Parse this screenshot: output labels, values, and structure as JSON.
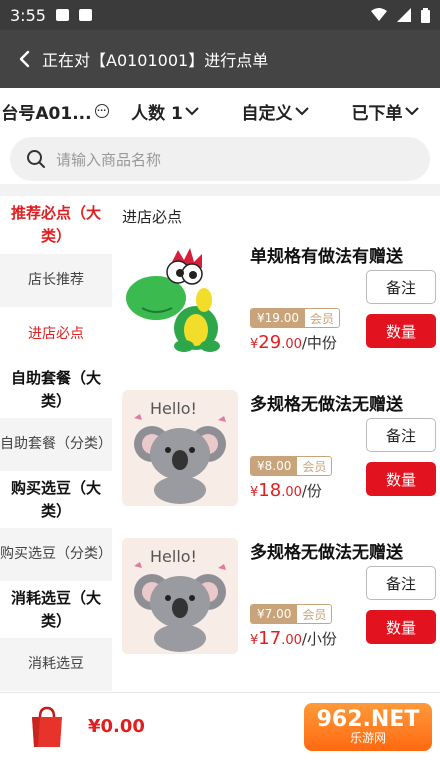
{
  "status": {
    "time": "3:55"
  },
  "header": {
    "title": "正在对【A0101001】进行点单"
  },
  "filters": [
    {
      "label": "台号A01..."
    },
    {
      "label": "人数 1"
    },
    {
      "label": "自定义"
    },
    {
      "label": "已下单"
    }
  ],
  "search": {
    "placeholder": "请输入商品名称"
  },
  "sidebar": {
    "items": [
      {
        "label": "推荐必点（大类）"
      },
      {
        "label": "店长推荐"
      },
      {
        "label": "进店必点"
      },
      {
        "label": "自助套餐（大类）"
      },
      {
        "label": "自助套餐（分类）"
      },
      {
        "label": "购买选豆（大类）"
      },
      {
        "label": "购买选豆（分类）"
      },
      {
        "label": "消耗选豆（大类）"
      },
      {
        "label": "消耗选豆"
      }
    ]
  },
  "main": {
    "section_title": "进店必点",
    "products": [
      {
        "name": "单规格有做法有赠送",
        "member_price": "¥19.00",
        "member_label": "会员",
        "price_symbol": "¥",
        "price_main": "29",
        "price_decimal": ".00",
        "unit": "/中份",
        "note_label": "备注",
        "qty_label": "数量"
      },
      {
        "name": "多规格无做法无赠送",
        "member_price": "¥8.00",
        "member_label": "会员",
        "price_symbol": "¥",
        "price_main": "18",
        "price_decimal": ".00",
        "unit": "/份",
        "note_label": "备注",
        "qty_label": "数量"
      },
      {
        "name": "多规格无做法无赠送",
        "member_price": "¥7.00",
        "member_label": "会员",
        "price_symbol": "¥",
        "price_main": "17",
        "price_decimal": ".00",
        "unit": "/小份",
        "note_label": "备注",
        "qty_label": "数量"
      }
    ]
  },
  "bottom": {
    "total": "¥0.00",
    "watermark_main": "962.NET",
    "watermark_sub": "乐游网"
  },
  "colors": {
    "accent": "#e21f20",
    "member": "#c9a47a",
    "header_bg": "#444444"
  }
}
